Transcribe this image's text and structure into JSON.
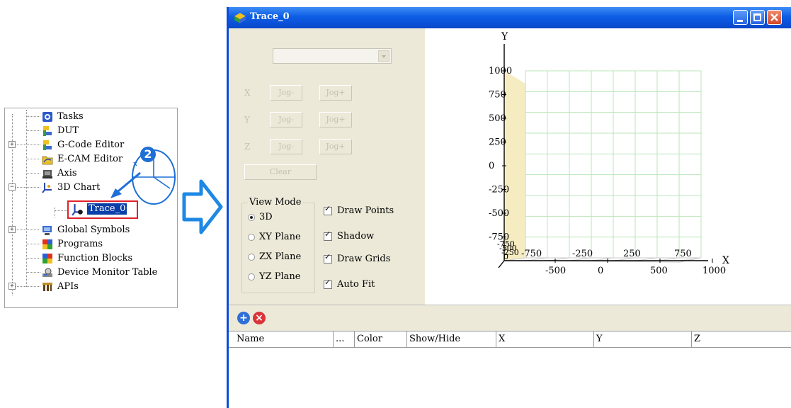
{
  "tree": {
    "items": [
      {
        "label": "Tasks",
        "icon": "gear-icon"
      },
      {
        "label": "DUT",
        "icon": "dut-icon"
      },
      {
        "label": "G-Code Editor",
        "icon": "gcode-icon"
      },
      {
        "label": "E-CAM Editor",
        "icon": "ecam-icon"
      },
      {
        "label": "Axis",
        "icon": "axis-icon"
      },
      {
        "label": "3D Chart",
        "icon": "chart3d-icon"
      },
      {
        "label": "Trace_0",
        "icon": "trace-icon"
      },
      {
        "label": "Global Symbols",
        "icon": "globe-icon"
      },
      {
        "label": "Programs",
        "icon": "programs-icon"
      },
      {
        "label": "Function Blocks",
        "icon": "function-blocks-icon"
      },
      {
        "label": "Device Monitor Table",
        "icon": "monitor-icon"
      },
      {
        "label": "APIs",
        "icon": "apis-icon"
      }
    ],
    "step_badge": "2"
  },
  "window": {
    "title": "Trace_0"
  },
  "controls": {
    "jog_rows": [
      {
        "axis": "X",
        "minus": "Jog-",
        "plus": "Jog+"
      },
      {
        "axis": "Y",
        "minus": "Jog-",
        "plus": "Jog+"
      },
      {
        "axis": "Z",
        "minus": "Jog-",
        "plus": "Jog+"
      }
    ],
    "clear_label": "Clear",
    "view_mode": {
      "legend": "View Mode",
      "options": [
        "3D",
        "XY Plane",
        "ZX Plane",
        "YZ Plane"
      ],
      "selected": "3D"
    },
    "checks": [
      {
        "label": "Draw Points",
        "checked": true
      },
      {
        "label": "Shadow",
        "checked": true
      },
      {
        "label": "Draw Grids",
        "checked": true
      },
      {
        "label": "Auto Fit",
        "checked": true
      }
    ]
  },
  "chart_data": {
    "type": "3d-axes",
    "x_axis_label": "X",
    "y_axis_label": "Y",
    "y_ticks": [
      "1000",
      "750",
      "500",
      "250",
      "0",
      "-250",
      "-500",
      "-750"
    ],
    "x_ticks_upper": [
      "-750",
      "-250",
      "250",
      "750"
    ],
    "x_ticks_lower": [
      "-500",
      "0",
      "500",
      "1000"
    ],
    "z_ticks_overlap": [
      "-750",
      "-500",
      "-250",
      "0"
    ],
    "grid_color": "#b8e6b8",
    "plane_color": "#f3e7b3"
  },
  "grid": {
    "columns": [
      "Name",
      "...",
      "Color",
      "Show/Hide",
      "X",
      "Y",
      "Z"
    ]
  },
  "colors": {
    "title_bar": "#0a4fd6",
    "highlight": "#e0202a",
    "arrow": "#1e88e5",
    "add_icon": "#2f6fd6",
    "remove_icon": "#d8343a"
  }
}
